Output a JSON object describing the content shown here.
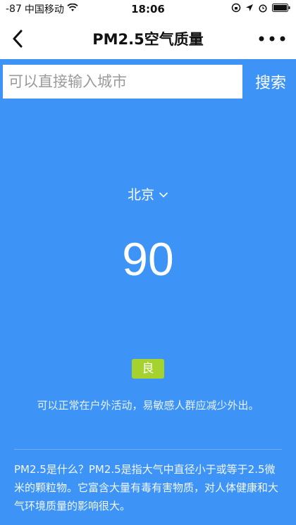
{
  "status_bar": {
    "signal": "-87",
    "carrier": "中国移动",
    "time": "18:06"
  },
  "nav": {
    "title": "PM2.5空气质量"
  },
  "search": {
    "placeholder": "可以直接输入城市",
    "button_label": "搜索"
  },
  "city": {
    "name": "北京"
  },
  "aqi": {
    "value": "90",
    "level": "良",
    "level_color": "#a5d22e",
    "advice": "可以正常在户外活动，易敏感人群应减少外出。"
  },
  "intro": {
    "text": "PM2.5是什么？PM2.5是指大气中直径小于或等于2.5微米的颗粒物。它富含大量有毒有害物质，对人体健康和大气环境质量的影响很大。"
  },
  "colors": {
    "background": "#3d94f6",
    "header": "#ffffff"
  }
}
